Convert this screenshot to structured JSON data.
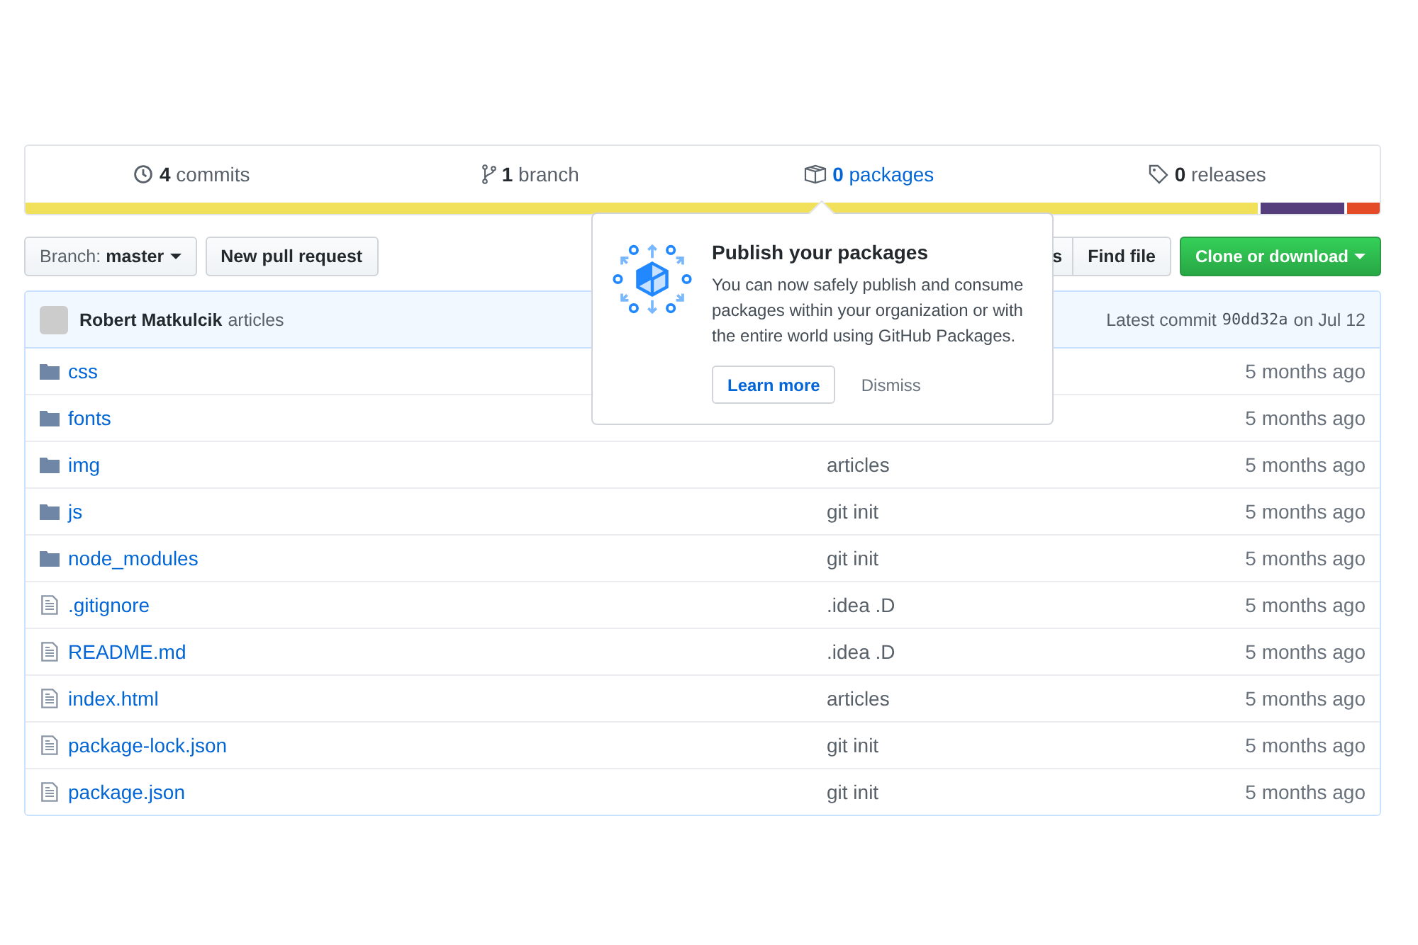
{
  "stats": [
    {
      "kind": "commits",
      "count": "4",
      "label": "commits",
      "link": false
    },
    {
      "kind": "branch",
      "count": "1",
      "label": "branch",
      "link": false
    },
    {
      "kind": "packages",
      "count": "0",
      "label": "packages",
      "link": true
    },
    {
      "kind": "releases",
      "count": "0",
      "label": "releases",
      "link": false
    }
  ],
  "language_bar": [
    {
      "color": "#f1e05a"
    },
    {
      "color": "#563d7c"
    },
    {
      "color": "#e34c26"
    }
  ],
  "toolbar": {
    "branch_label": "Branch:",
    "branch": "master",
    "new_pull_request": "New pull request",
    "partial_button": "s",
    "find_file": "Find file",
    "clone": "Clone or download"
  },
  "commit": {
    "author": "Robert Matkulcik",
    "message": "articles",
    "latest_label": "Latest commit",
    "sha": "90dd32a",
    "date": "on Jul 12"
  },
  "files": [
    {
      "kind": "folder",
      "name": "css",
      "age": "5 months ago"
    },
    {
      "kind": "folder",
      "name": "fonts",
      "age": "5 months ago"
    },
    {
      "kind": "folder",
      "name": "img",
      "message": "articles",
      "age": "5 months ago"
    },
    {
      "kind": "folder",
      "name": "js",
      "message": "git init",
      "age": "5 months ago"
    },
    {
      "kind": "folder",
      "name": "node_modules",
      "message": "git init",
      "age": "5 months ago"
    },
    {
      "kind": "file",
      "name": ".gitignore",
      "message": ".idea .D",
      "age": "5 months ago"
    },
    {
      "kind": "file",
      "name": "README.md",
      "message": ".idea .D",
      "age": "5 months ago"
    },
    {
      "kind": "file",
      "name": "index.html",
      "message": "articles",
      "age": "5 months ago"
    },
    {
      "kind": "file",
      "name": "package-lock.json",
      "message": "git init",
      "age": "5 months ago"
    },
    {
      "kind": "file",
      "name": "package.json",
      "message": "git init",
      "age": "5 months ago"
    }
  ],
  "popover": {
    "title": "Publish your packages",
    "body": "You can now safely publish and consume packages within your organization or with the entire world using GitHub Packages.",
    "learn_more": "Learn more",
    "dismiss": "Dismiss"
  }
}
